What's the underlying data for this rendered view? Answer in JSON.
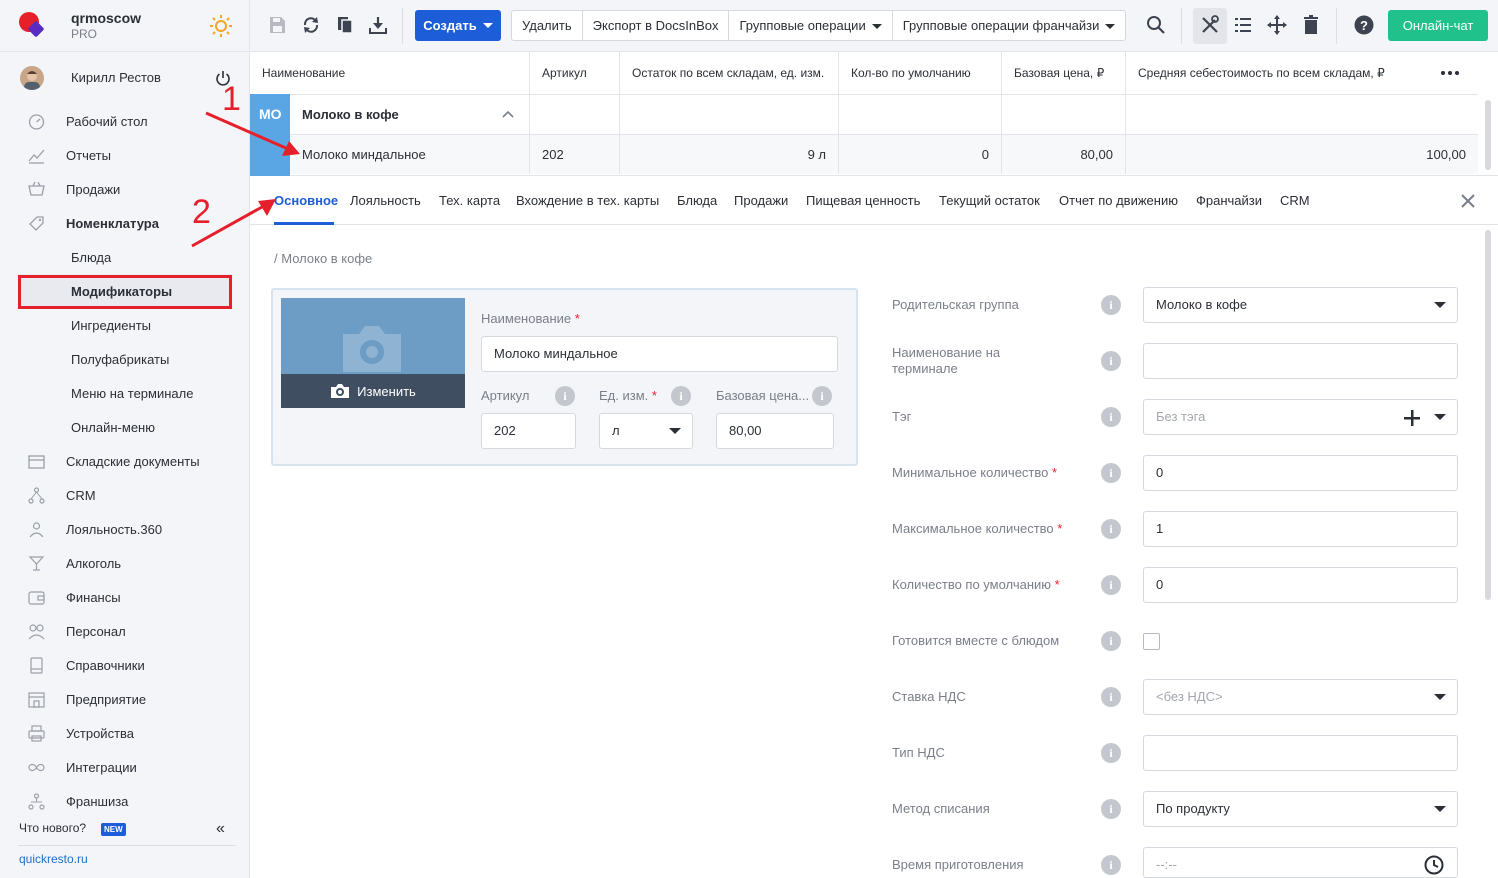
{
  "brand": {
    "name": "qrmoscow",
    "plan": "PRO"
  },
  "user": {
    "name": "Кирилл Рестов"
  },
  "nav": {
    "items": [
      {
        "label": "Рабочий стол",
        "icon": "dashboard-icon"
      },
      {
        "label": "Отчеты",
        "icon": "reports-icon"
      },
      {
        "label": "Продажи",
        "icon": "cart-icon"
      },
      {
        "label": "Номенклатура",
        "icon": "tag-icon"
      }
    ],
    "sub": [
      {
        "label": "Блюда"
      },
      {
        "label": "Модификаторы"
      },
      {
        "label": "Ингредиенты"
      },
      {
        "label": "Полуфабрикаты"
      },
      {
        "label": "Меню на терминале"
      },
      {
        "label": "Онлайн-меню"
      }
    ],
    "items2": [
      {
        "label": "Складские документы"
      },
      {
        "label": "CRM"
      },
      {
        "label": "Лояльность.360"
      },
      {
        "label": "Алкоголь"
      },
      {
        "label": "Финансы"
      },
      {
        "label": "Персонал"
      },
      {
        "label": "Справочники"
      },
      {
        "label": "Предприятие"
      },
      {
        "label": "Устройства"
      },
      {
        "label": "Интеграции"
      },
      {
        "label": "Франшиза"
      }
    ],
    "whats_new": "Что нового?",
    "new_badge": "NEW",
    "site_link": "quickresto.ru"
  },
  "toolbar": {
    "create": "Создать",
    "delete": "Удалить",
    "export": "Экспорт в DocsInBox",
    "group_ops": "Групповые операции",
    "group_ops_fr": "Групповые операции франчайзи",
    "chat": "Онлайн-чат"
  },
  "grid": {
    "headers": [
      "Наименование",
      "Артикул",
      "Остаток по всем складам, ед. изм.",
      "Кол-во по умолчанию",
      "Базовая цена, ₽",
      "Средняя себестоимость по всем складам, ₽"
    ],
    "group": {
      "badge": "МО",
      "name": "Молоко в кофе"
    },
    "row": {
      "name": "Молоко миндальное",
      "article": "202",
      "stock": "9 л",
      "default_qty": "0",
      "price": "80,00",
      "cost": "100,00"
    }
  },
  "tabs": [
    "Основное",
    "Лояльность",
    "Тех. карта",
    "Вхождение в тех. карты",
    "Блюда",
    "Продажи",
    "Пищевая ценность",
    "Текущий остаток",
    "Отчет по движению",
    "Франчайзи",
    "CRM"
  ],
  "breadcrumb": "/ Молоко в кофе",
  "card": {
    "change_photo": "Изменить",
    "name_label": "Наименование",
    "name_value": "Молоко миндальное",
    "article_label": "Артикул",
    "article_value": "202",
    "unit_label": "Ед. изм.",
    "unit_value": "л",
    "price_label": "Базовая цена...",
    "price_value": "80,00"
  },
  "fields": {
    "parent_group": {
      "label": "Родительская группа",
      "value": "Молоко в кофе"
    },
    "terminal_name": {
      "label": "Наименование на терминале",
      "value": ""
    },
    "tag": {
      "label": "Тэг",
      "placeholder": "Без тэга"
    },
    "min_qty": {
      "label": "Минимальное количество",
      "value": "0"
    },
    "max_qty": {
      "label": "Максимальное количество",
      "value": "1"
    },
    "default_qty": {
      "label": "Количество по умолчанию",
      "value": "0"
    },
    "cooked_with": {
      "label": "Готовится вместе с блюдом"
    },
    "vat_rate": {
      "label": "Ставка НДС",
      "placeholder": "<без НДС>"
    },
    "vat_type": {
      "label": "Тип НДС",
      "value": ""
    },
    "writeoff": {
      "label": "Метод списания",
      "value": "По продукту"
    },
    "cook_time": {
      "label": "Время приготовления",
      "placeholder": "--:--"
    }
  },
  "annotations": {
    "one": "1",
    "two": "2"
  },
  "colors": {
    "accent": "#1d5dd8",
    "chat": "#20c18a",
    "highlight": "#e6202b",
    "group_badge": "#5aa6e4"
  }
}
